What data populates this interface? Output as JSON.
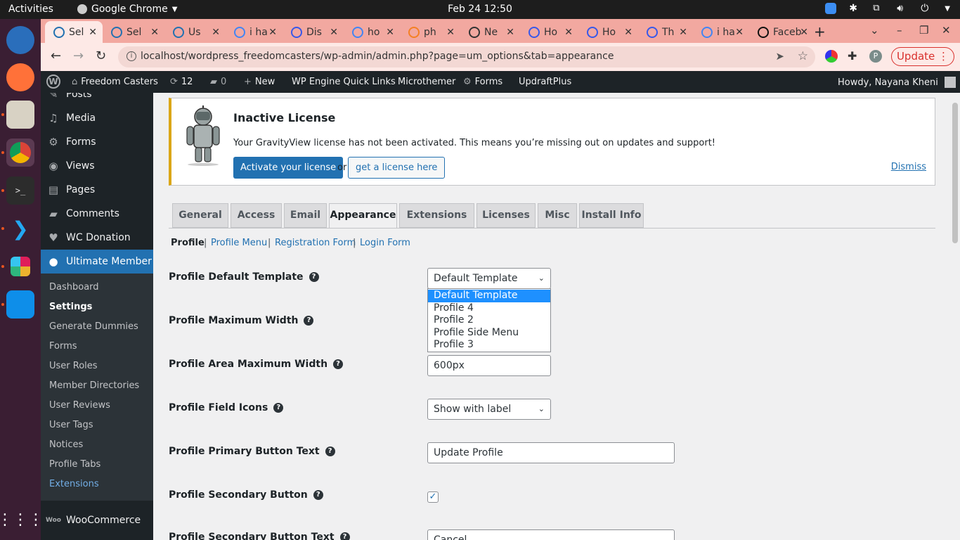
{
  "gnome": {
    "activities": "Activities",
    "app_name": "Google Chrome",
    "clock": "Feb 24  12:50"
  },
  "browser": {
    "tabs": [
      {
        "label": "Sel",
        "icon": "wifi-icon",
        "color": "#2271b1"
      },
      {
        "label": "Sel",
        "icon": "wifi-icon",
        "color": "#2271b1"
      },
      {
        "label": "Us",
        "icon": "wifi-icon",
        "color": "#2271b1"
      },
      {
        "label": "i ha",
        "icon": "google-icon",
        "color": "#4285f4"
      },
      {
        "label": "Dis",
        "icon": "plug-icon",
        "color": "#3858e9"
      },
      {
        "label": "ho",
        "icon": "google-icon",
        "color": "#4285f4"
      },
      {
        "label": "ph",
        "icon": "stackoverflow-icon",
        "color": "#f48024"
      },
      {
        "label": "Ne",
        "icon": "github-icon",
        "color": "#333333"
      },
      {
        "label": "Ho",
        "icon": "plug-icon",
        "color": "#3858e9"
      },
      {
        "label": "Ho",
        "icon": "plug-icon",
        "color": "#3858e9"
      },
      {
        "label": "Th",
        "icon": "plug-icon",
        "color": "#3858e9"
      },
      {
        "label": "i ha",
        "icon": "google-icon",
        "color": "#4285f4"
      },
      {
        "label": "Faceb",
        "icon": "codepen-icon",
        "color": "#111111"
      }
    ],
    "url": "localhost/wordpress_freedomcasters/wp-admin/admin.php?page=um_options&tab=appearance",
    "update_label": "Update",
    "profile_initial": "P"
  },
  "adminbar": {
    "site_name": "Freedom Casters",
    "updates_count": "12",
    "comments_count": "0",
    "new_label": "New",
    "wpengine": "WP Engine Quick Links",
    "microthemer": "Microthemer",
    "forms": "Forms",
    "updraft": "UpdraftPlus",
    "howdy": "Howdy, Nayana Kheni"
  },
  "sidebar": {
    "items": [
      {
        "label": "Posts",
        "icon": "pin-icon"
      },
      {
        "label": "Media",
        "icon": "media-icon"
      },
      {
        "label": "Forms",
        "icon": "forms-icon"
      },
      {
        "label": "Views",
        "icon": "views-icon"
      },
      {
        "label": "Pages",
        "icon": "pages-icon"
      },
      {
        "label": "Comments",
        "icon": "comments-icon"
      },
      {
        "label": "WC Donation",
        "icon": "heart-icon"
      },
      {
        "label": "Ultimate Member",
        "icon": "user-icon"
      }
    ],
    "submenu": [
      "Dashboard",
      "Settings",
      "Generate Dummies",
      "Forms",
      "User Roles",
      "Member Directories",
      "User Reviews",
      "User Tags",
      "Notices",
      "Profile Tabs",
      "Extensions"
    ],
    "woocommerce": "WooCommerce"
  },
  "notice": {
    "title": "Inactive License",
    "message": "Your GravityView license has not been activated. This means you’re missing out on updates and support!",
    "activate": "Activate your license",
    "or": "or",
    "get_license": "get a license here",
    "dismiss": "Dismiss"
  },
  "tabs": [
    "General",
    "Access",
    "Email",
    "Appearance",
    "Extensions",
    "Licenses",
    "Misc",
    "Install Info"
  ],
  "subnav": [
    "Profile",
    "Profile Menu",
    "Registration Form",
    "Login Form"
  ],
  "fields": {
    "default_template": {
      "label": "Profile Default Template",
      "value": "Default Template"
    },
    "max_width": {
      "label": "Profile Maximum Width"
    },
    "area_max_width": {
      "label": "Profile Area Maximum Width",
      "value": "600px"
    },
    "field_icons": {
      "label": "Profile Field Icons",
      "value": "Show with label"
    },
    "primary_button": {
      "label": "Profile Primary Button Text",
      "value": "Update Profile"
    },
    "secondary_button": {
      "label": "Profile Secondary Button",
      "checked": true
    },
    "secondary_button_text": {
      "label": "Profile Secondary Button Text",
      "value": "Cancel"
    }
  },
  "dropdown_options": [
    "Default Template",
    "Profile 4",
    "Profile 2",
    "Profile Side Menu",
    "Profile 3"
  ],
  "help_glyph": "?",
  "colors": {
    "accent": "#2271b1",
    "admin_dark": "#1d2327",
    "notice_warning": "#dba617",
    "tab_strip": "#f2a8a0"
  }
}
